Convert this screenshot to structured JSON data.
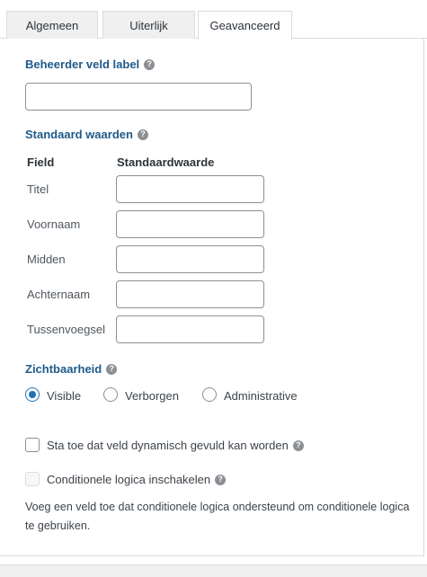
{
  "tabs": [
    {
      "label": "Algemeen",
      "active": false
    },
    {
      "label": "Uiterlijk",
      "active": false
    },
    {
      "label": "Geavanceerd",
      "active": true
    }
  ],
  "admin_label": {
    "title": "Beheerder veld label",
    "help_icon": "question-circle-icon",
    "value": ""
  },
  "defaults": {
    "title": "Standaard waarden",
    "help_icon": "question-circle-icon",
    "col_field": "Field",
    "col_default": "Standaardwaarde",
    "rows": [
      {
        "label": "Titel",
        "value": ""
      },
      {
        "label": "Voornaam",
        "value": ""
      },
      {
        "label": "Midden",
        "value": ""
      },
      {
        "label": "Achternaam",
        "value": ""
      },
      {
        "label": "Tussenvoegsel",
        "value": ""
      }
    ]
  },
  "visibility": {
    "title": "Zichtbaarheid",
    "help_icon": "question-circle-icon",
    "options": [
      {
        "label": "Visible",
        "checked": true
      },
      {
        "label": "Verborgen",
        "checked": false
      },
      {
        "label": "Administrative",
        "checked": false
      }
    ]
  },
  "dynamic_fill": {
    "label": "Sta toe dat veld dynamisch gevuld kan worden",
    "checked": false,
    "help_icon": "question-circle-icon"
  },
  "conditional_logic": {
    "label": "Conditionele logica inschakelen",
    "checked": false,
    "disabled": true,
    "help_icon": "question-circle-icon",
    "description": "Voeg een veld toe dat conditionele logica ondersteund om conditionele logica te gebruiken."
  },
  "colors": {
    "section_title": "#1e5a8a",
    "accent": "#2271b1",
    "border": "#dcdcde"
  }
}
